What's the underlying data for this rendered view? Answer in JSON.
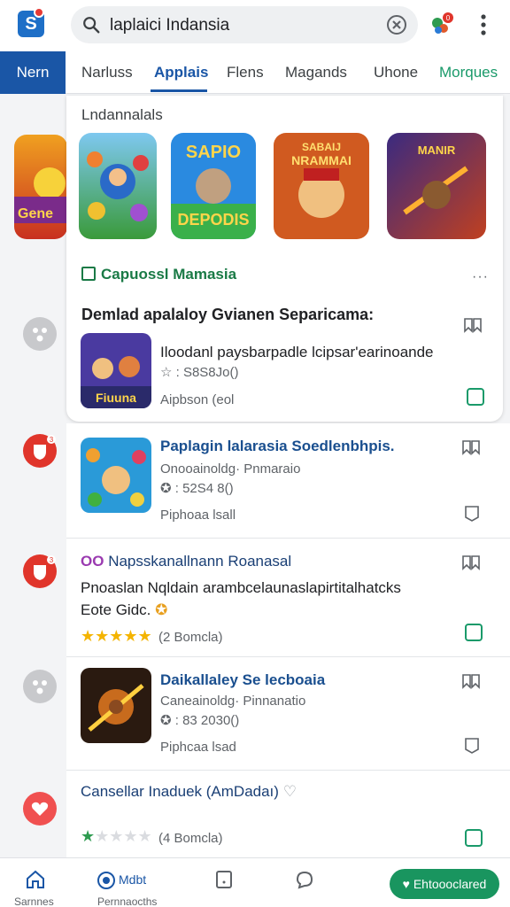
{
  "app": {
    "logo_letter": "S"
  },
  "search": {
    "query": "laplaici Indansia"
  },
  "tabs": [
    "Nern",
    "Narluss",
    "Applais",
    "Flens",
    "Magands",
    "Uhone",
    "Morques"
  ],
  "side": {
    "card_label": "Gene"
  },
  "panel": {
    "heading": "Lndannalals",
    "thumbs": [
      {
        "name": "game-thumb-1"
      },
      {
        "name": "game-thumb-2",
        "text_top": "SAPIO",
        "text_bottom": "DEPODIS"
      },
      {
        "name": "game-thumb-3",
        "text_top": "SABAIJ",
        "text_bottom": "NRAMMAI"
      },
      {
        "name": "game-thumb-4",
        "text_top": "MANIR"
      }
    ],
    "section_title": "Capuossl Mamasia",
    "section_more": "···",
    "featured": {
      "title": "Demlad apalaloy Gvianen Separicama:",
      "icon_text": "Fiuuna",
      "subtitle": "Iloodanl paysbarpadle lcipsar'earinoande",
      "meta": "☆ : S8S8Jo()",
      "by": "Aipbson (eol"
    }
  },
  "rows": [
    {
      "title": "Paplagin lalarasia Soedlenbhpis.",
      "sub": "Onooainoldg· Pnmaraio",
      "meta": "✪ : 52S4 8()",
      "by": "Piphoaa lsall"
    },
    {
      "title": "Napsskanallnann Roanasal",
      "prefix": "OO",
      "line1": "Pnoaslan Nqldain arambcelaunaslapirtitalhatcks",
      "line2": "Eote Gidc.",
      "rating_text": "(2 Bomcla)",
      "stars": 5
    },
    {
      "title": "Daikallaley Se lecboaia",
      "sub": "Caneainoldg· Pinnanatio",
      "meta": "✪ : 83 2030()",
      "by": "Piphcaa lsad"
    },
    {
      "title": "Cansellar Inaduek (AmDadaı)",
      "rating_text": "(4 Bomcla)",
      "stars": 1
    }
  ],
  "bottom_nav": {
    "home_label": "Sarnnes",
    "middle_label": "Pernnaocths",
    "badge_label": "Mdbt",
    "cta_label": "Ehtoooclared"
  },
  "colors": {
    "accent_blue": "#1a56a6",
    "accent_green": "#19955f",
    "badge_red": "#e0352b"
  }
}
